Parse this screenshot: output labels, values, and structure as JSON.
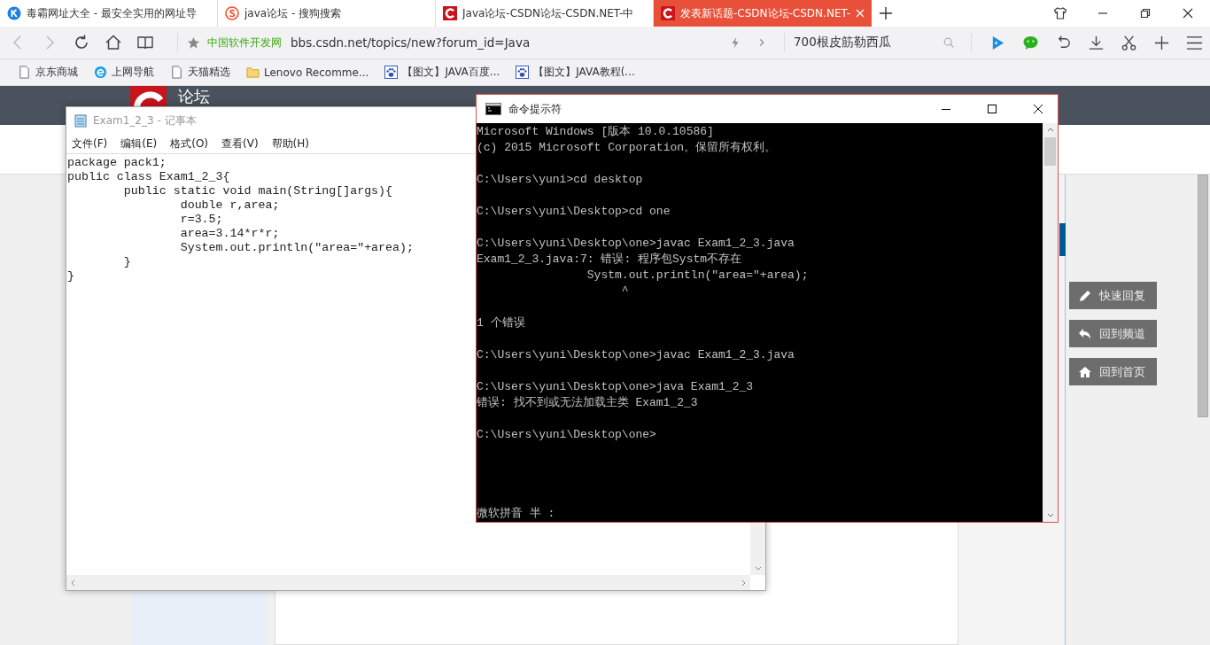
{
  "browser": {
    "tabs": [
      {
        "title": "毒霸网址大全 - 最安全实用的网址导",
        "kind": "kbadge",
        "selected": false
      },
      {
        "title": "java论坛 - 搜狗搜索",
        "kind": "sbadge",
        "selected": false
      },
      {
        "title": "Java论坛-CSDN论坛-CSDN.NET-中",
        "kind": "cbadge",
        "selected": false
      },
      {
        "title": "发表新话题-CSDN论坛-CSDN.NET-",
        "kind": "cbadge",
        "selected": true
      }
    ],
    "address": {
      "site": "中国软件开发网",
      "url": "bbs.csdn.net/topics/new?forum_id=Java"
    },
    "search": {
      "value": "700根皮筋勒西瓜"
    },
    "bookmarks": [
      {
        "label": "京东商城",
        "kind": "page"
      },
      {
        "label": "上网导航",
        "kind": "ie"
      },
      {
        "label": "天猫精选",
        "kind": "page"
      },
      {
        "label": "Lenovo Recomme...",
        "kind": "folder"
      },
      {
        "label": "【图文】JAVA百度...",
        "kind": "paw"
      },
      {
        "label": "【图文】JAVA教程(...",
        "kind": "paw"
      }
    ]
  },
  "page": {
    "header_title": "论坛",
    "side_buttons": [
      {
        "label": "快速回复",
        "kind": "pencil"
      },
      {
        "label": "回到频道",
        "kind": "reply"
      },
      {
        "label": "回到首页",
        "kind": "home"
      }
    ]
  },
  "notepad": {
    "title": "Exam1_2_3 - 记事本",
    "menu": [
      "文件(F)",
      "编辑(E)",
      "格式(O)",
      "查看(V)",
      "帮助(H)"
    ],
    "lines": [
      "package pack1;",
      "public class Exam1_2_3{",
      "\tpublic static void main(String[]args){",
      "\t\tdouble r,area;",
      "\t\tr=3.5;",
      "\t\tarea=3.14*r*r;",
      "\t\tSystem.out.println(\"area=\"+area);",
      "\t}",
      "}"
    ]
  },
  "cmd": {
    "title": "命令提示符",
    "blocks": [
      [
        "Microsoft Windows [版本 10.0.10586]",
        "(c) 2015 Microsoft Corporation。保留所有权利。"
      ],
      [
        "C:\\Users\\yuni>cd desktop"
      ],
      [
        "C:\\Users\\yuni\\Desktop>cd one"
      ],
      [
        "C:\\Users\\yuni\\Desktop\\one>javac Exam1_2_3.java",
        "Exam1_2_3.java:7: 错误: 程序包Systm不存在",
        "                Systm.out.println(\"area=\"+area);",
        "                     ^"
      ],
      [
        "1 个错误"
      ],
      [
        "C:\\Users\\yuni\\Desktop\\one>javac Exam1_2_3.java"
      ],
      [
        "C:\\Users\\yuni\\Desktop\\one>java Exam1_2_3",
        "错误: 找不到或无法加载主类 Exam1_2_3"
      ],
      [
        "C:\\Users\\yuni\\Desktop\\one>"
      ]
    ],
    "ime_status": "微软拼音 半 :"
  }
}
